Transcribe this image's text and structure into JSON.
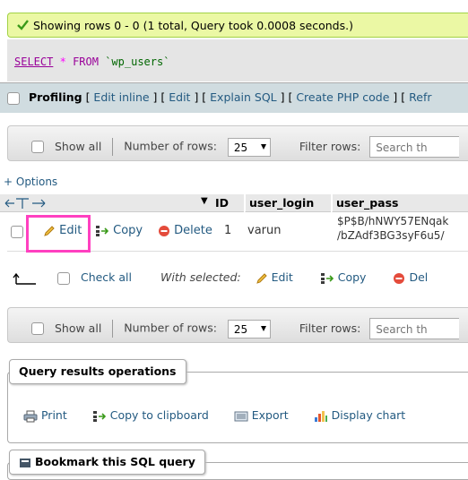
{
  "success": {
    "message": "Showing rows 0 - 0 (1 total, Query took 0.0008 seconds.)"
  },
  "sql": {
    "select": "SELECT",
    "star": "*",
    "from": "FROM",
    "table": "`wp_users`"
  },
  "toolbar": {
    "profiling": "Profiling",
    "links": [
      "Edit inline",
      "Edit",
      "Explain SQL",
      "Create PHP code",
      "Refr"
    ]
  },
  "nav": {
    "show_all": "Show all",
    "number_of_rows_label": "Number of rows:",
    "rows_value": "25",
    "filter_label": "Filter rows:",
    "search_placeholder": "Search th"
  },
  "options": {
    "label": "+ Options"
  },
  "table": {
    "columns": [
      "ID",
      "user_login",
      "user_pass"
    ],
    "row": {
      "edit": "Edit",
      "copy": "Copy",
      "delete": "Delete",
      "id": "1",
      "user_login": "varun",
      "user_pass_line1": "$P$B/hNWY57ENqak",
      "user_pass_line2": "/bZAdf3BG3syF6u5/"
    }
  },
  "bulk": {
    "check_all": "Check all",
    "with_selected": "With selected:",
    "edit": "Edit",
    "copy": "Copy",
    "delete": "Del"
  },
  "ops": {
    "legend": "Query results operations",
    "print": "Print",
    "copy_clipboard": "Copy to clipboard",
    "export": "Export",
    "display_chart": "Display chart"
  },
  "bookmark": {
    "legend": "Bookmark this SQL query"
  },
  "colors": {
    "highlight": "#ff40c0",
    "success_bg": "#ebf8a4",
    "link": "#235a81"
  }
}
